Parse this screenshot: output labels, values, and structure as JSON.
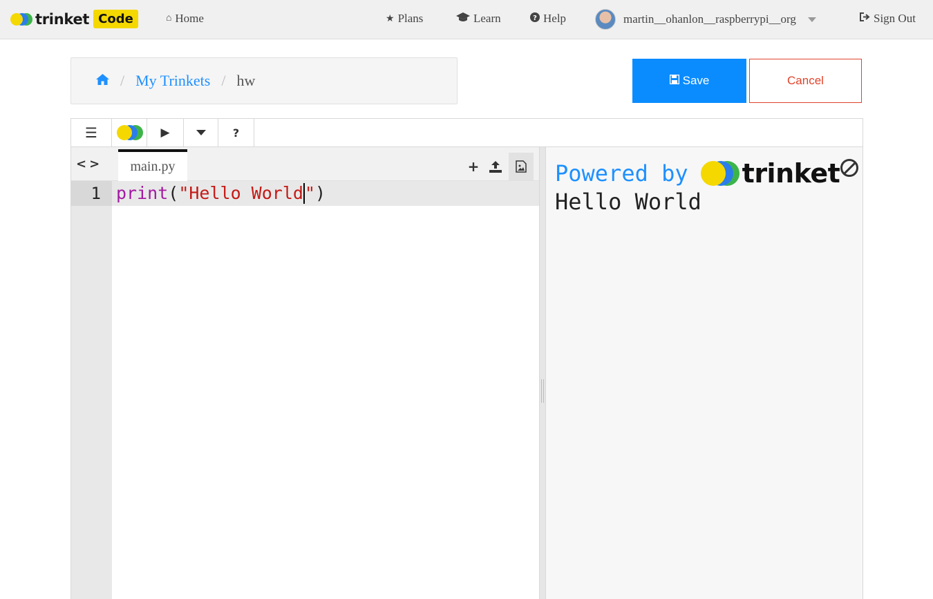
{
  "navbar": {
    "brand_name": "trinket",
    "brand_badge": "Code",
    "home": "Home",
    "plans": "Plans",
    "learn": "Learn",
    "help": "Help",
    "username": "martin__ohanlon__raspberrypi__org",
    "sign_out": "Sign Out"
  },
  "breadcrumb": {
    "link": "My Trinkets",
    "current": "hw",
    "separator": "/"
  },
  "actions": {
    "save": "Save",
    "cancel": "Cancel"
  },
  "toolbar": {
    "menu_icon": "menu-icon",
    "help": "?"
  },
  "editor": {
    "file_tab": "main.py",
    "line_number": "1",
    "code": {
      "func": "print",
      "open": "(",
      "str_before_cursor": "\"Hello World",
      "str_after_cursor": "\"",
      "close": ")"
    }
  },
  "output": {
    "powered_by": "Powered by",
    "brand": "trinket",
    "text": "Hello World"
  },
  "colors": {
    "accent": "#0a8cff",
    "cancel": "#e0432a",
    "brand_yellow": "#f5d800",
    "brand_blue": "#2b7de9",
    "brand_green": "#3db44a"
  }
}
